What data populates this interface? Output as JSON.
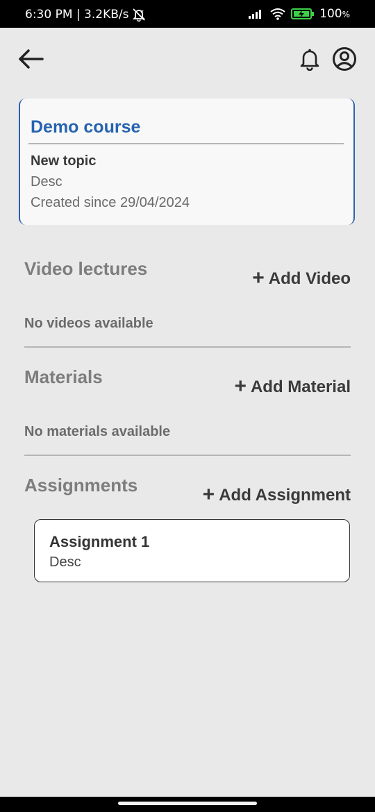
{
  "status_bar": {
    "time_speed": "6:30 PM | 3.2KB/s",
    "battery": "100",
    "battery_unit": "%"
  },
  "app_bar": {
    "back_icon": "arrow-left-icon",
    "notification_icon": "bell-icon",
    "profile_icon": "account-circle-icon"
  },
  "course": {
    "title": "Demo course",
    "topic_title": "New topic",
    "topic_desc": "Desc",
    "created": "Created since 29/04/2024"
  },
  "sections": {
    "videos": {
      "heading": "Video lectures",
      "add_label": "Add Video",
      "empty": "No videos available"
    },
    "materials": {
      "heading": "Materials",
      "add_label": "Add Material",
      "empty": "No materials available"
    },
    "assignments": {
      "heading": "Assignments",
      "add_label": "Add Assignment",
      "items": [
        {
          "title": "Assignment 1",
          "desc": "Desc"
        }
      ]
    }
  },
  "colors": {
    "accent": "#2563b0",
    "background": "#e9e9e9"
  }
}
